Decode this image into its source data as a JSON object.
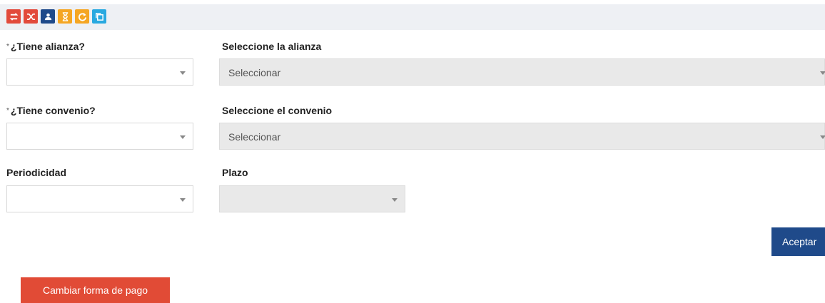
{
  "toolbar": {
    "buttons": [
      {
        "icon": "swap-icon",
        "color": "#e24a3b"
      },
      {
        "icon": "shuffle-icon",
        "color": "#e24a3b"
      },
      {
        "icon": "user-icon",
        "color": "#1f4a8a"
      },
      {
        "icon": "hourglass-icon",
        "color": "#f5a623"
      },
      {
        "icon": "refresh-icon",
        "color": "#f5a623"
      },
      {
        "icon": "copy-icon",
        "color": "#29a9e0"
      }
    ]
  },
  "form": {
    "tiene_alianza": {
      "label": "¿Tiene alianza?",
      "required_mark": "*",
      "value": ""
    },
    "seleccione_alianza": {
      "label": "Seleccione la alianza",
      "value": "Seleccionar"
    },
    "tiene_convenio": {
      "label": "¿Tiene convenio?",
      "required_mark": "*",
      "value": ""
    },
    "seleccione_convenio": {
      "label": "Seleccione el convenio",
      "value": "Seleccionar"
    },
    "periodicidad": {
      "label": "Periodicidad",
      "value": ""
    },
    "plazo": {
      "label": "Plazo",
      "value": ""
    }
  },
  "actions": {
    "accept_label": "Aceptar",
    "change_payment_label": "Cambiar forma de pago"
  }
}
